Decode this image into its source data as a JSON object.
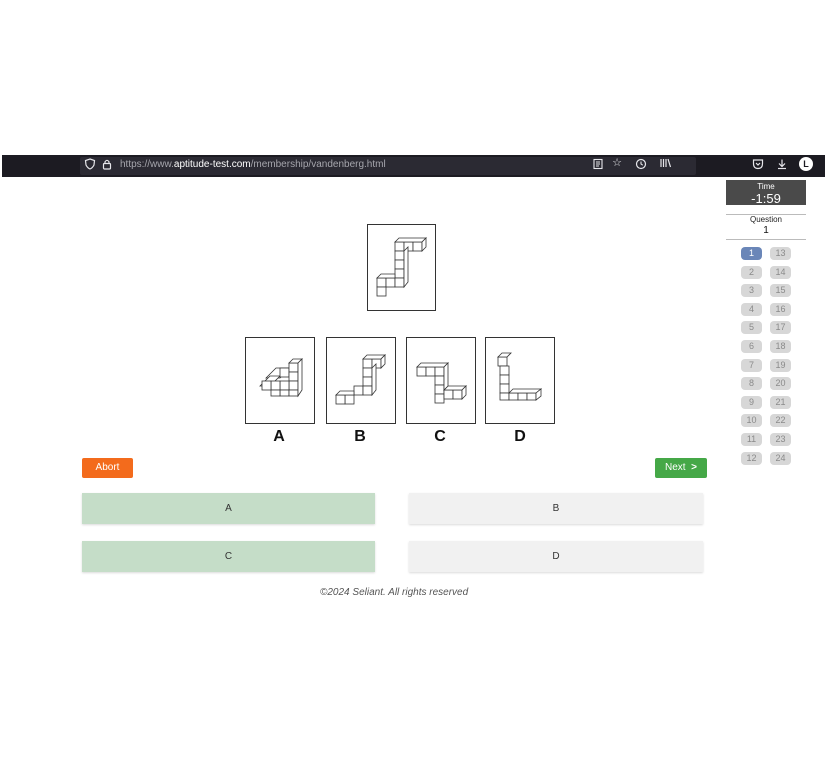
{
  "browser": {
    "url_prefix": "https://www.",
    "url_domain": "aptitude-test.com",
    "url_path": "/membership/vandenberg.html",
    "profile_initial": "L"
  },
  "timer": {
    "label": "Time",
    "value": "-1:59"
  },
  "question": {
    "label": "Question",
    "number": "1"
  },
  "question_nav": {
    "col1": [
      "1",
      "2",
      "3",
      "4",
      "5",
      "6",
      "7",
      "8",
      "9",
      "10",
      "11",
      "12"
    ],
    "col2": [
      "13",
      "14",
      "15",
      "16",
      "17",
      "18",
      "19",
      "20",
      "21",
      "22",
      "23",
      "24"
    ],
    "active": "1"
  },
  "options_labels": [
    "A",
    "B",
    "C",
    "D"
  ],
  "buttons": {
    "abort": "Abort",
    "next": "Next",
    "next_icon": ">"
  },
  "answers": [
    "A",
    "B",
    "C",
    "D"
  ],
  "footer": "©2024 Seliant. All rights reserved",
  "colors": {
    "abort": "#f36b1c",
    "next": "#45a847",
    "selected_answer": "#c5ddc8",
    "active_question": "#6a86b8"
  }
}
